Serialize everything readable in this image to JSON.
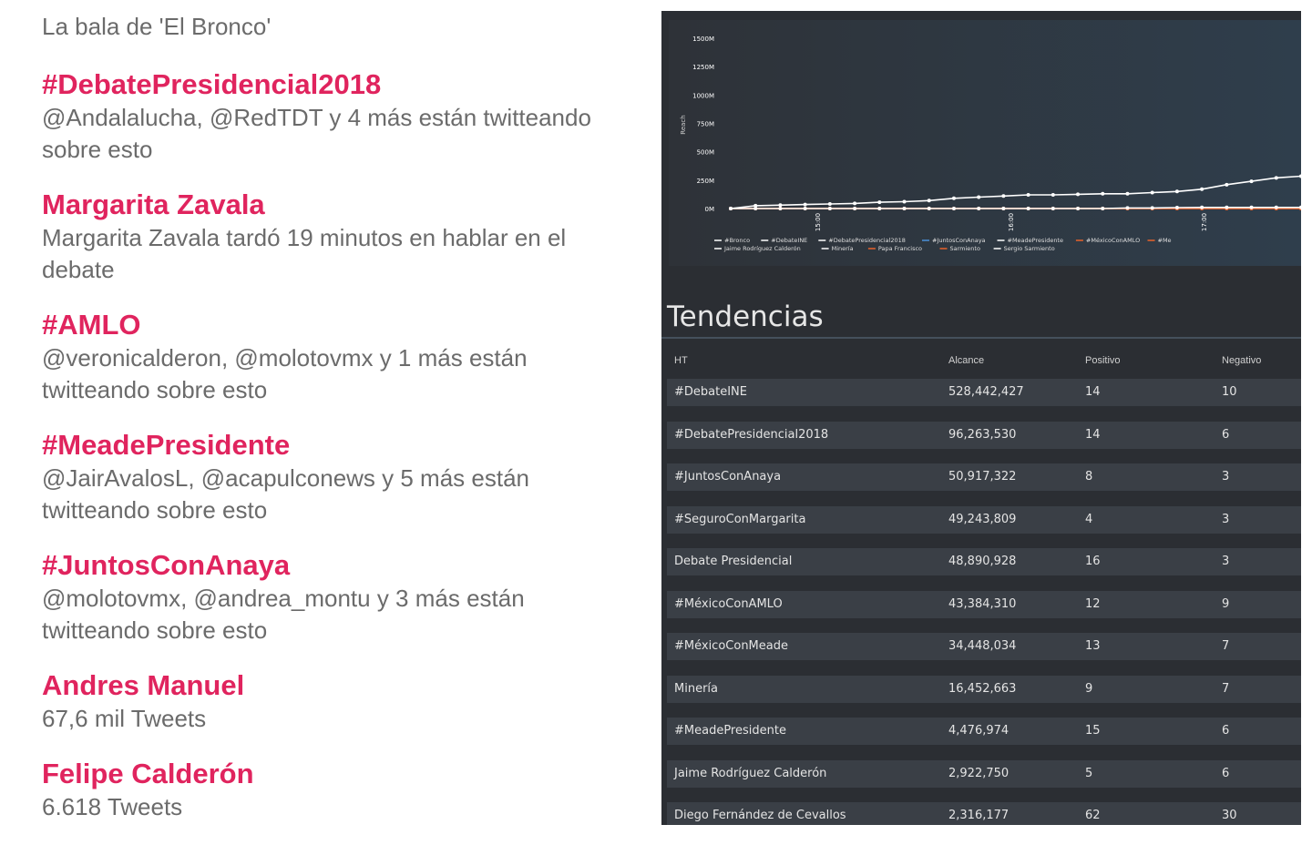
{
  "left": {
    "header": "La bala de 'El Bronco'",
    "trends": [
      {
        "title": "#DebatePresidencial2018",
        "subtitle": "@Andalalucha, @RedTDT y 4 más están twitteando sobre esto"
      },
      {
        "title": "Margarita Zavala",
        "subtitle": "Margarita Zavala tardó 19 minutos en hablar en el debate"
      },
      {
        "title": "#AMLO",
        "subtitle": "@veronicalderon, @molotovmx y 1 más están twitteando sobre esto"
      },
      {
        "title": "#MeadePresidente",
        "subtitle": "@JairAvalosL, @acapulconews y 5 más están twitteando sobre esto"
      },
      {
        "title": "#JuntosConAnaya",
        "subtitle": "@molotovmx, @andrea_montu y 3 más están twitteando sobre esto"
      },
      {
        "title": "Andres Manuel",
        "subtitle": "67,6 mil Tweets"
      },
      {
        "title": "Felipe Calderón",
        "subtitle": "6.618 Tweets"
      }
    ]
  },
  "dashboard": {
    "section_title": "Tendencias",
    "columns": [
      "HT",
      "Alcance",
      "Positivo",
      "Negativo"
    ],
    "rows": [
      [
        "#DebateINE",
        "528,442,427",
        "14",
        "10"
      ],
      [
        "#DebatePresidencial2018",
        "96,263,530",
        "14",
        "6"
      ],
      [
        "#JuntosConAnaya",
        "50,917,322",
        "8",
        "3"
      ],
      [
        "#SeguroConMargarita",
        "49,243,809",
        "4",
        "3"
      ],
      [
        "Debate Presidencial",
        "48,890,928",
        "16",
        "3"
      ],
      [
        "#MéxicoConAMLO",
        "43,384,310",
        "12",
        "9"
      ],
      [
        "#MéxicoConMeade",
        "34,448,034",
        "13",
        "7"
      ],
      [
        "Minería",
        "16,452,663",
        "9",
        "7"
      ],
      [
        "#MeadePresidente",
        "4,476,974",
        "15",
        "6"
      ],
      [
        "Jaime Rodríguez Calderón",
        "2,922,750",
        "5",
        "6"
      ],
      [
        "Diego Fernández de Cevallos",
        "2,316,177",
        "62",
        "30"
      ]
    ]
  },
  "colors": {
    "trend_accent": "#e0245e",
    "muted_text": "#6b6b6b",
    "panel_bg": "#2b2e33",
    "row_bg": "#3a3f46",
    "white_series": "#ffffff",
    "orange_series": "#e8622b",
    "blue_series": "#4a90d9"
  },
  "chart_data": {
    "type": "line",
    "ylabel": "Reach",
    "yticks": [
      "0M",
      "250M",
      "500M",
      "750M",
      "1000M",
      "1250M",
      "1500M"
    ],
    "ylim": [
      0,
      1500
    ],
    "xticks": [
      "15:00",
      "16:00",
      "17:00"
    ],
    "legend_position": "bottom",
    "series": [
      {
        "name": "#Bronco",
        "color": "#ffffff",
        "values": [
          0,
          25,
          30,
          35,
          40,
          45,
          55,
          60,
          70,
          90,
          100,
          110,
          120,
          120,
          125,
          130,
          130,
          140,
          150,
          170,
          210,
          240,
          270,
          285
        ]
      },
      {
        "name": "Jaime Rodríguez Calderón",
        "color": "#ffffff",
        "values": [
          0,
          0,
          0,
          0,
          0,
          0,
          0,
          0,
          0,
          0,
          0,
          0,
          0,
          0,
          0,
          0,
          5,
          5,
          8,
          10,
          10,
          10,
          10,
          10
        ]
      },
      {
        "name": "Papa Francisco",
        "color": "#e8622b",
        "values": [
          0,
          0,
          0,
          0,
          0,
          0,
          0,
          0,
          0,
          0,
          0,
          0,
          0,
          0,
          0,
          0,
          0,
          0,
          0,
          0,
          0,
          0,
          0,
          0
        ]
      },
      {
        "name": "Sarmiento",
        "color": "#e8622b",
        "values": [
          0,
          0,
          0,
          0,
          0,
          0,
          0,
          0,
          0,
          0,
          0,
          0,
          0,
          0,
          0,
          0,
          0,
          0,
          0,
          0,
          0,
          0,
          0,
          0
        ]
      }
    ],
    "legend": [
      {
        "label": "#Bronco",
        "color": "#ffffff"
      },
      {
        "label": "#DebateINE",
        "color": "#ffffff"
      },
      {
        "label": "#DebatePresidencial2018",
        "color": "#ffffff"
      },
      {
        "label": "#JuntosConAnaya",
        "color": "#4a90d9"
      },
      {
        "label": "#MeadePresidente",
        "color": "#ffffff"
      },
      {
        "label": "#MéxicoConAMLO",
        "color": "#e8622b"
      },
      {
        "label": "#Me",
        "color": "#e8622b"
      },
      {
        "label": "Jaime Rodríguez Calderón",
        "color": "#ffffff"
      },
      {
        "label": "Minería",
        "color": "#ffffff"
      },
      {
        "label": "Papa Francisco",
        "color": "#e8622b"
      },
      {
        "label": "Sarmiento",
        "color": "#e8622b"
      },
      {
        "label": "Sergio Sarmiento",
        "color": "#ffffff"
      }
    ]
  }
}
